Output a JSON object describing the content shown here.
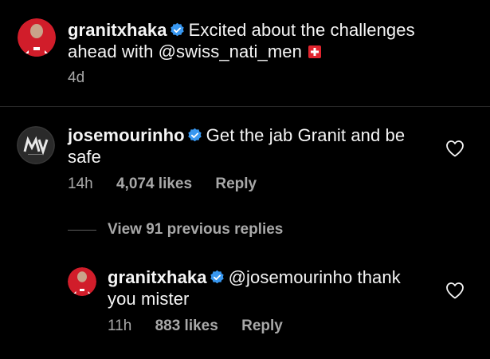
{
  "caption": {
    "username": "granitxhaka",
    "text_line1": "Excited about the challenges",
    "text_line2": "ahead with @swiss_nati_men",
    "time": "4d",
    "flag_icon": "swiss-flag-icon"
  },
  "comment": {
    "username": "josemourinho",
    "text_line1": "Get the jab Granit and be",
    "text_line2": "safe",
    "time": "14h",
    "likes": "4,074 likes",
    "reply_label": "Reply"
  },
  "view_replies": {
    "label": "View 91 previous replies"
  },
  "reply": {
    "username": "granitxhaka",
    "text_line1": "@josemourinho thank",
    "text_line2": "you mister",
    "time": "11h",
    "likes": "883 likes",
    "reply_label": "Reply"
  },
  "colors": {
    "background": "#000000",
    "text": "#f5f5f5",
    "secondary": "#a8a8a8",
    "verified": "#3897f0",
    "arsenal_red": "#d11d2a"
  }
}
